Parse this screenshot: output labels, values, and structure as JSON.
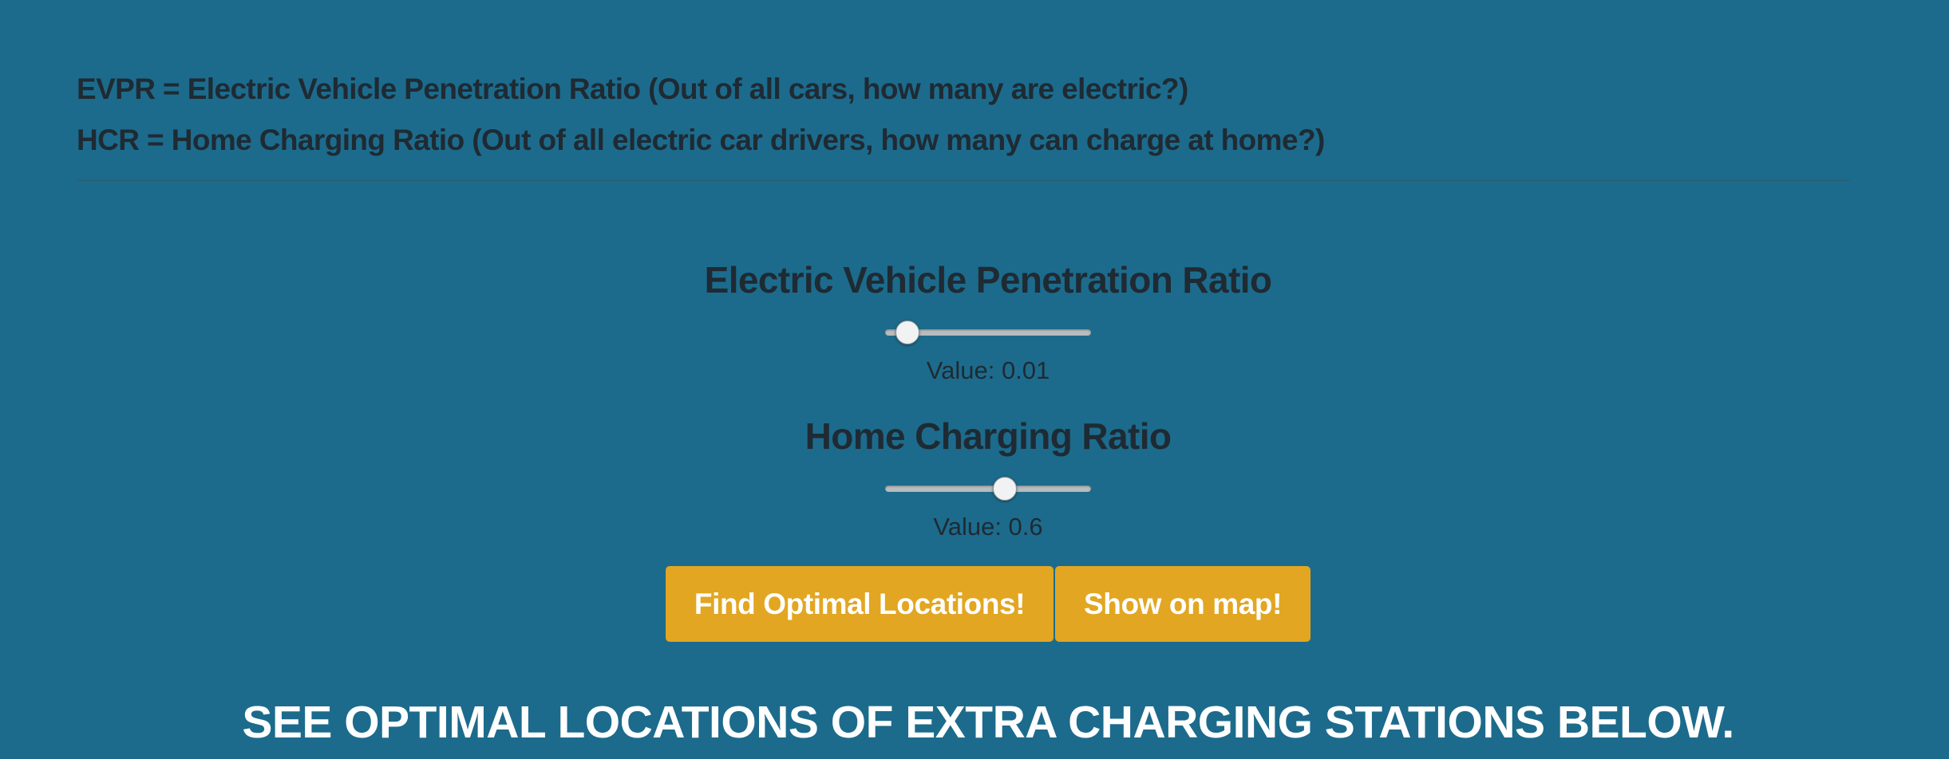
{
  "definitions": {
    "evpr": "EVPR = Electric Vehicle Penetration Ratio (Out of all cars, how many are electric?)",
    "hcr": "HCR = Home Charging Ratio (Out of all electric car drivers, how many can charge at home?)"
  },
  "sliders": {
    "evpr": {
      "title": "Electric Vehicle Penetration Ratio",
      "value_prefix": "Value: ",
      "value_text": "0.01",
      "value": 0.01,
      "min": 0,
      "max": 1
    },
    "hcr": {
      "title": "Home Charging Ratio",
      "value_prefix": "Value: ",
      "value_text": "0.6",
      "value": 0.6,
      "min": 0,
      "max": 1
    }
  },
  "buttons": {
    "find_label": "Find Optimal Locations!",
    "map_label": "Show on map!"
  },
  "banner": "SEE OPTIMAL LOCATIONS OF EXTRA CHARGING STATIONS BELOW.",
  "colors": {
    "background": "#1c6b8c",
    "button": "#e2a622",
    "text_dark": "#1f2a33",
    "text_light": "#ffffff"
  }
}
